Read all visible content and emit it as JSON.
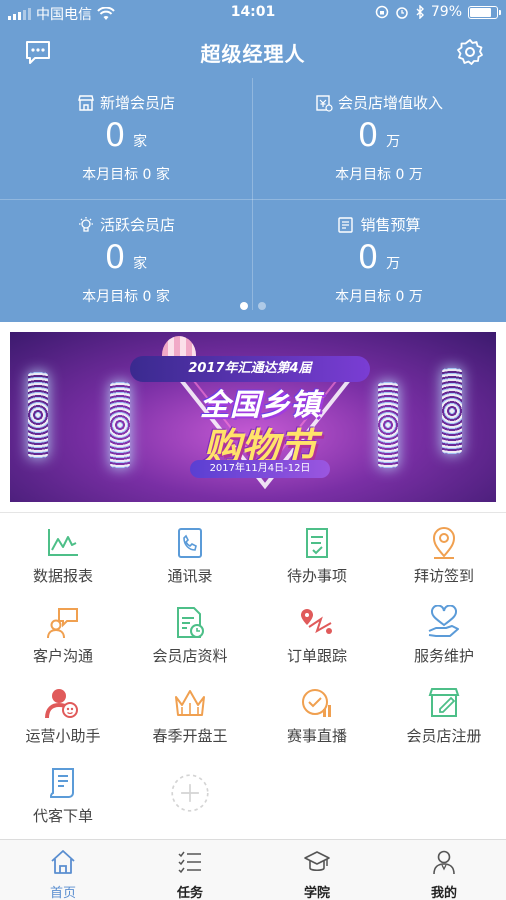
{
  "status_bar": {
    "carrier": "中国电信",
    "time": "14:01",
    "battery_text": "79%",
    "battery_level": 0.79
  },
  "header": {
    "title": "超级经理人",
    "left_icon": "chat-icon",
    "right_icon": "gear-icon"
  },
  "stats": [
    {
      "label": "新增会员店",
      "icon": "store-icon",
      "value": "0",
      "unit": "家",
      "target": "本月目标 0 家"
    },
    {
      "label": "会员店增值收入",
      "icon": "revenue-icon",
      "value": "0",
      "unit": "万",
      "target": "本月目标 0 万"
    },
    {
      "label": "活跃会员店",
      "icon": "bulb-icon",
      "value": "0",
      "unit": "家",
      "target": "本月目标 0 家"
    },
    {
      "label": "销售预算",
      "icon": "budget-icon",
      "value": "0",
      "unit": "万",
      "target": "本月目标 0 万"
    }
  ],
  "pager": {
    "count": 2,
    "active": 0
  },
  "banner": {
    "headline": "2017年汇通达第4届",
    "title_line1": "全国乡镇",
    "title_line2": "购物节",
    "date": "2017年11月4日-12日"
  },
  "grid": [
    {
      "label": "数据报表",
      "icon": "chart-icon",
      "color": "#4dbf88"
    },
    {
      "label": "通讯录",
      "icon": "contacts-icon",
      "color": "#5b9bd8"
    },
    {
      "label": "待办事项",
      "icon": "todo-icon",
      "color": "#4dbf88"
    },
    {
      "label": "拜访签到",
      "icon": "location-icon",
      "color": "#f0a050"
    },
    {
      "label": "客户沟通",
      "icon": "customer-chat-icon",
      "color": "#f0a050"
    },
    {
      "label": "会员店资料",
      "icon": "document-icon",
      "color": "#4dbf88"
    },
    {
      "label": "订单跟踪",
      "icon": "route-icon",
      "color": "#e05a5a"
    },
    {
      "label": "服务维护",
      "icon": "heart-hand-icon",
      "color": "#5b9bd8"
    },
    {
      "label": "运营小助手",
      "icon": "assistant-icon",
      "color": "#e05a5a"
    },
    {
      "label": "春季开盘王",
      "icon": "crown-icon",
      "color": "#f0a050"
    },
    {
      "label": "赛事直播",
      "icon": "live-icon",
      "color": "#f0a050"
    },
    {
      "label": "会员店注册",
      "icon": "store-register-icon",
      "color": "#4dbf88"
    },
    {
      "label": "代客下单",
      "icon": "order-icon",
      "color": "#5b9bd8"
    }
  ],
  "add_button": {
    "icon": "plus-icon"
  },
  "tabbar": [
    {
      "label": "首页",
      "icon": "home-icon",
      "active": true
    },
    {
      "label": "任务",
      "icon": "task-list-icon",
      "active": false
    },
    {
      "label": "学院",
      "icon": "graduation-cap-icon",
      "active": false
    },
    {
      "label": "我的",
      "icon": "user-icon",
      "active": false
    }
  ],
  "colors": {
    "header_bg": "#6d9fd3",
    "tab_active": "#5a8ed0"
  }
}
